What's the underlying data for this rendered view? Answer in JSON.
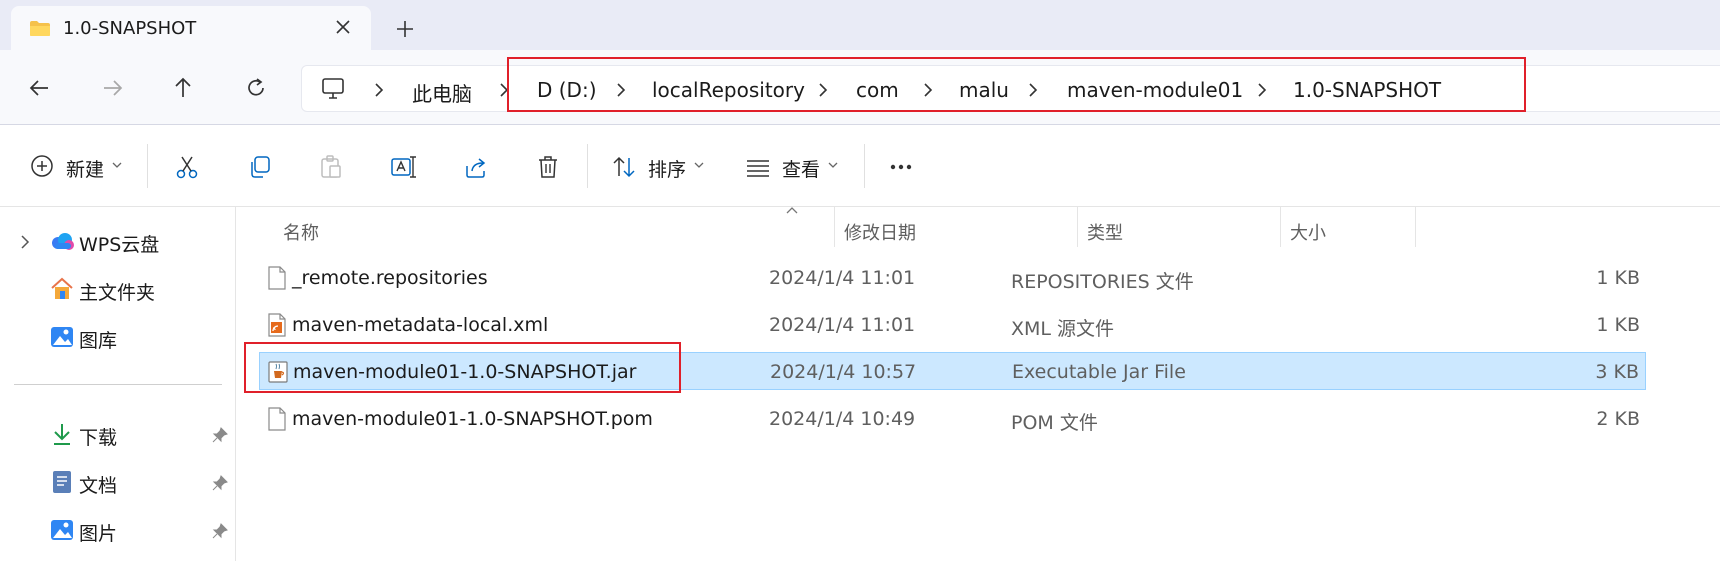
{
  "tab": {
    "title": "1.0-SNAPSHOT",
    "close_icon": "close-icon",
    "new_tab_icon": "plus-icon"
  },
  "nav_buttons": [
    "back-arrow-icon",
    "forward-arrow-icon",
    "up-arrow-icon",
    "refresh-icon"
  ],
  "breadcrumb": {
    "items": [
      "此电脑",
      "D (D:)",
      "localRepository",
      "com",
      "malu",
      "maven-module01",
      "1.0-SNAPSHOT"
    ]
  },
  "toolbar": {
    "new_label": "新建",
    "sort_label": "排序",
    "view_label": "查看"
  },
  "sidebar": {
    "items": [
      {
        "label": "WPS云盘",
        "icon": "cloud-icon"
      },
      {
        "label": "主文件夹",
        "icon": "home-icon"
      },
      {
        "label": "图库",
        "icon": "gallery-icon"
      },
      {
        "label": "下载",
        "icon": "download-icon"
      },
      {
        "label": "文档",
        "icon": "document-icon"
      },
      {
        "label": "图片",
        "icon": "pictures-icon"
      }
    ]
  },
  "columns": {
    "name": "名称",
    "date": "修改日期",
    "type": "类型",
    "size": "大小"
  },
  "files": [
    {
      "name": "_remote.repositories",
      "date": "2024/1/4 11:01",
      "type": "REPOSITORIES 文件",
      "size": "1 KB",
      "icon": "generic-file-icon"
    },
    {
      "name": "maven-metadata-local.xml",
      "date": "2024/1/4 11:01",
      "type": "XML 源文件",
      "size": "1 KB",
      "icon": "xml-file-icon"
    },
    {
      "name": "maven-module01-1.0-SNAPSHOT.jar",
      "date": "2024/1/4 10:57",
      "type": "Executable Jar File",
      "size": "3 KB",
      "icon": "jar-file-icon",
      "selected": true
    },
    {
      "name": "maven-module01-1.0-SNAPSHOT.pom",
      "date": "2024/1/4 10:49",
      "type": "POM 文件",
      "size": "2 KB",
      "icon": "generic-file-icon"
    }
  ],
  "colors": {
    "highlight": "#e0202a",
    "selection": "#cce8ff",
    "accent": "#0067c0"
  }
}
